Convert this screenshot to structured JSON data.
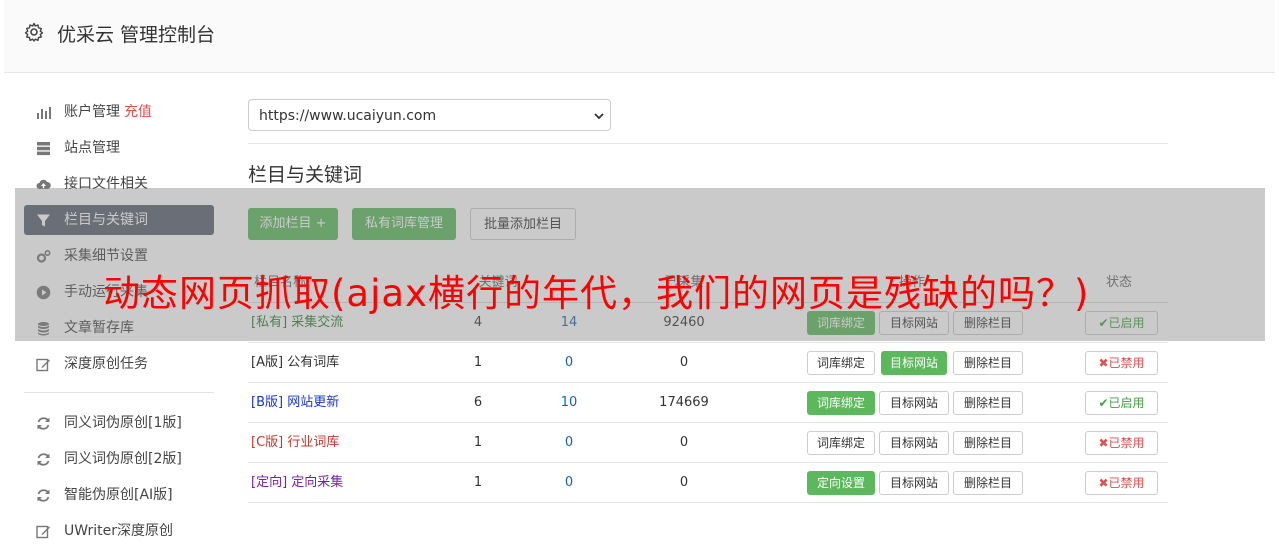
{
  "header": {
    "title": "优采云 管理控制台",
    "icon": "gear-icon"
  },
  "sidebar": {
    "items": [
      {
        "label": "账户管理",
        "badge": "充值",
        "icon": "bar-chart-icon"
      },
      {
        "label": "站点管理",
        "icon": "server-icon"
      },
      {
        "label": "接口文件相关",
        "icon": "cloud-upload-icon"
      },
      {
        "label": "栏目与关键词",
        "icon": "filter-icon",
        "active": true
      },
      {
        "label": "采集细节设置",
        "icon": "cogs-icon"
      },
      {
        "label": "手动运行采集",
        "icon": "play-circle-icon"
      },
      {
        "label": "文章暂存库",
        "icon": "database-icon"
      },
      {
        "label": "深度原创任务",
        "icon": "edit-icon"
      }
    ],
    "items2": [
      {
        "label": "同义词伪原创[1版]",
        "icon": "refresh-icon"
      },
      {
        "label": "同义词伪原创[2版]",
        "icon": "refresh-icon"
      },
      {
        "label": "智能伪原创[AI版]",
        "icon": "refresh-icon"
      },
      {
        "label": "UWriter深度原创",
        "icon": "edit-icon"
      }
    ]
  },
  "main": {
    "site_select": "https://www.ucaiyun.com",
    "section_title": "栏目与关键词",
    "buttons": {
      "add": "添加栏目 +",
      "private_lib": "私有词库管理",
      "batch_add": "批量添加栏目"
    },
    "columns": [
      "栏目名称",
      "关键词",
      "已采集",
      "操作",
      "状态"
    ],
    "rows": [
      {
        "prefix": "[私有]",
        "name": "采集交流",
        "k1": "4",
        "k2": "14",
        "collected": "92460",
        "btn1": "词库绑定",
        "btn1_green": true,
        "btn2": "目标网站",
        "btn2_green": false,
        "btn3": "删除栏目",
        "status": "已启用",
        "status_on": true
      },
      {
        "prefix": "[A版]",
        "name": "公有词库",
        "k1": "1",
        "k2": "0",
        "collected": "0",
        "btn1": "词库绑定",
        "btn1_green": false,
        "btn2": "目标网站",
        "btn2_green": true,
        "btn3": "删除栏目",
        "status": "已禁用",
        "status_on": false
      },
      {
        "prefix": "[B版]",
        "name": "网站更新",
        "k1": "6",
        "k2": "10",
        "collected": "174669",
        "btn1": "词库绑定",
        "btn1_green": true,
        "btn2": "目标网站",
        "btn2_green": false,
        "btn3": "删除栏目",
        "status": "已启用",
        "status_on": true
      },
      {
        "prefix": "[C版]",
        "name": "行业词库",
        "k1": "1",
        "k2": "0",
        "collected": "0",
        "btn1": "词库绑定",
        "btn1_green": false,
        "btn2": "目标网站",
        "btn2_green": false,
        "btn3": "删除栏目",
        "status": "已禁用",
        "status_on": false
      },
      {
        "prefix": "[定向]",
        "name": "定向采集",
        "k1": "1",
        "k2": "0",
        "collected": "0",
        "btn1": "定向设置",
        "btn1_green": true,
        "btn2": "目标网站",
        "btn2_green": false,
        "btn3": "删除栏目",
        "status": "已禁用",
        "status_on": false
      }
    ]
  },
  "overlay_text": "动态网页抓取(ajax横行的年代，我们的网页是残缺的吗？)",
  "colors": {
    "green": "#5cb85c",
    "red": "#d9534f",
    "active_nav": "#5a6271",
    "overlay_text": "#ff0000"
  }
}
